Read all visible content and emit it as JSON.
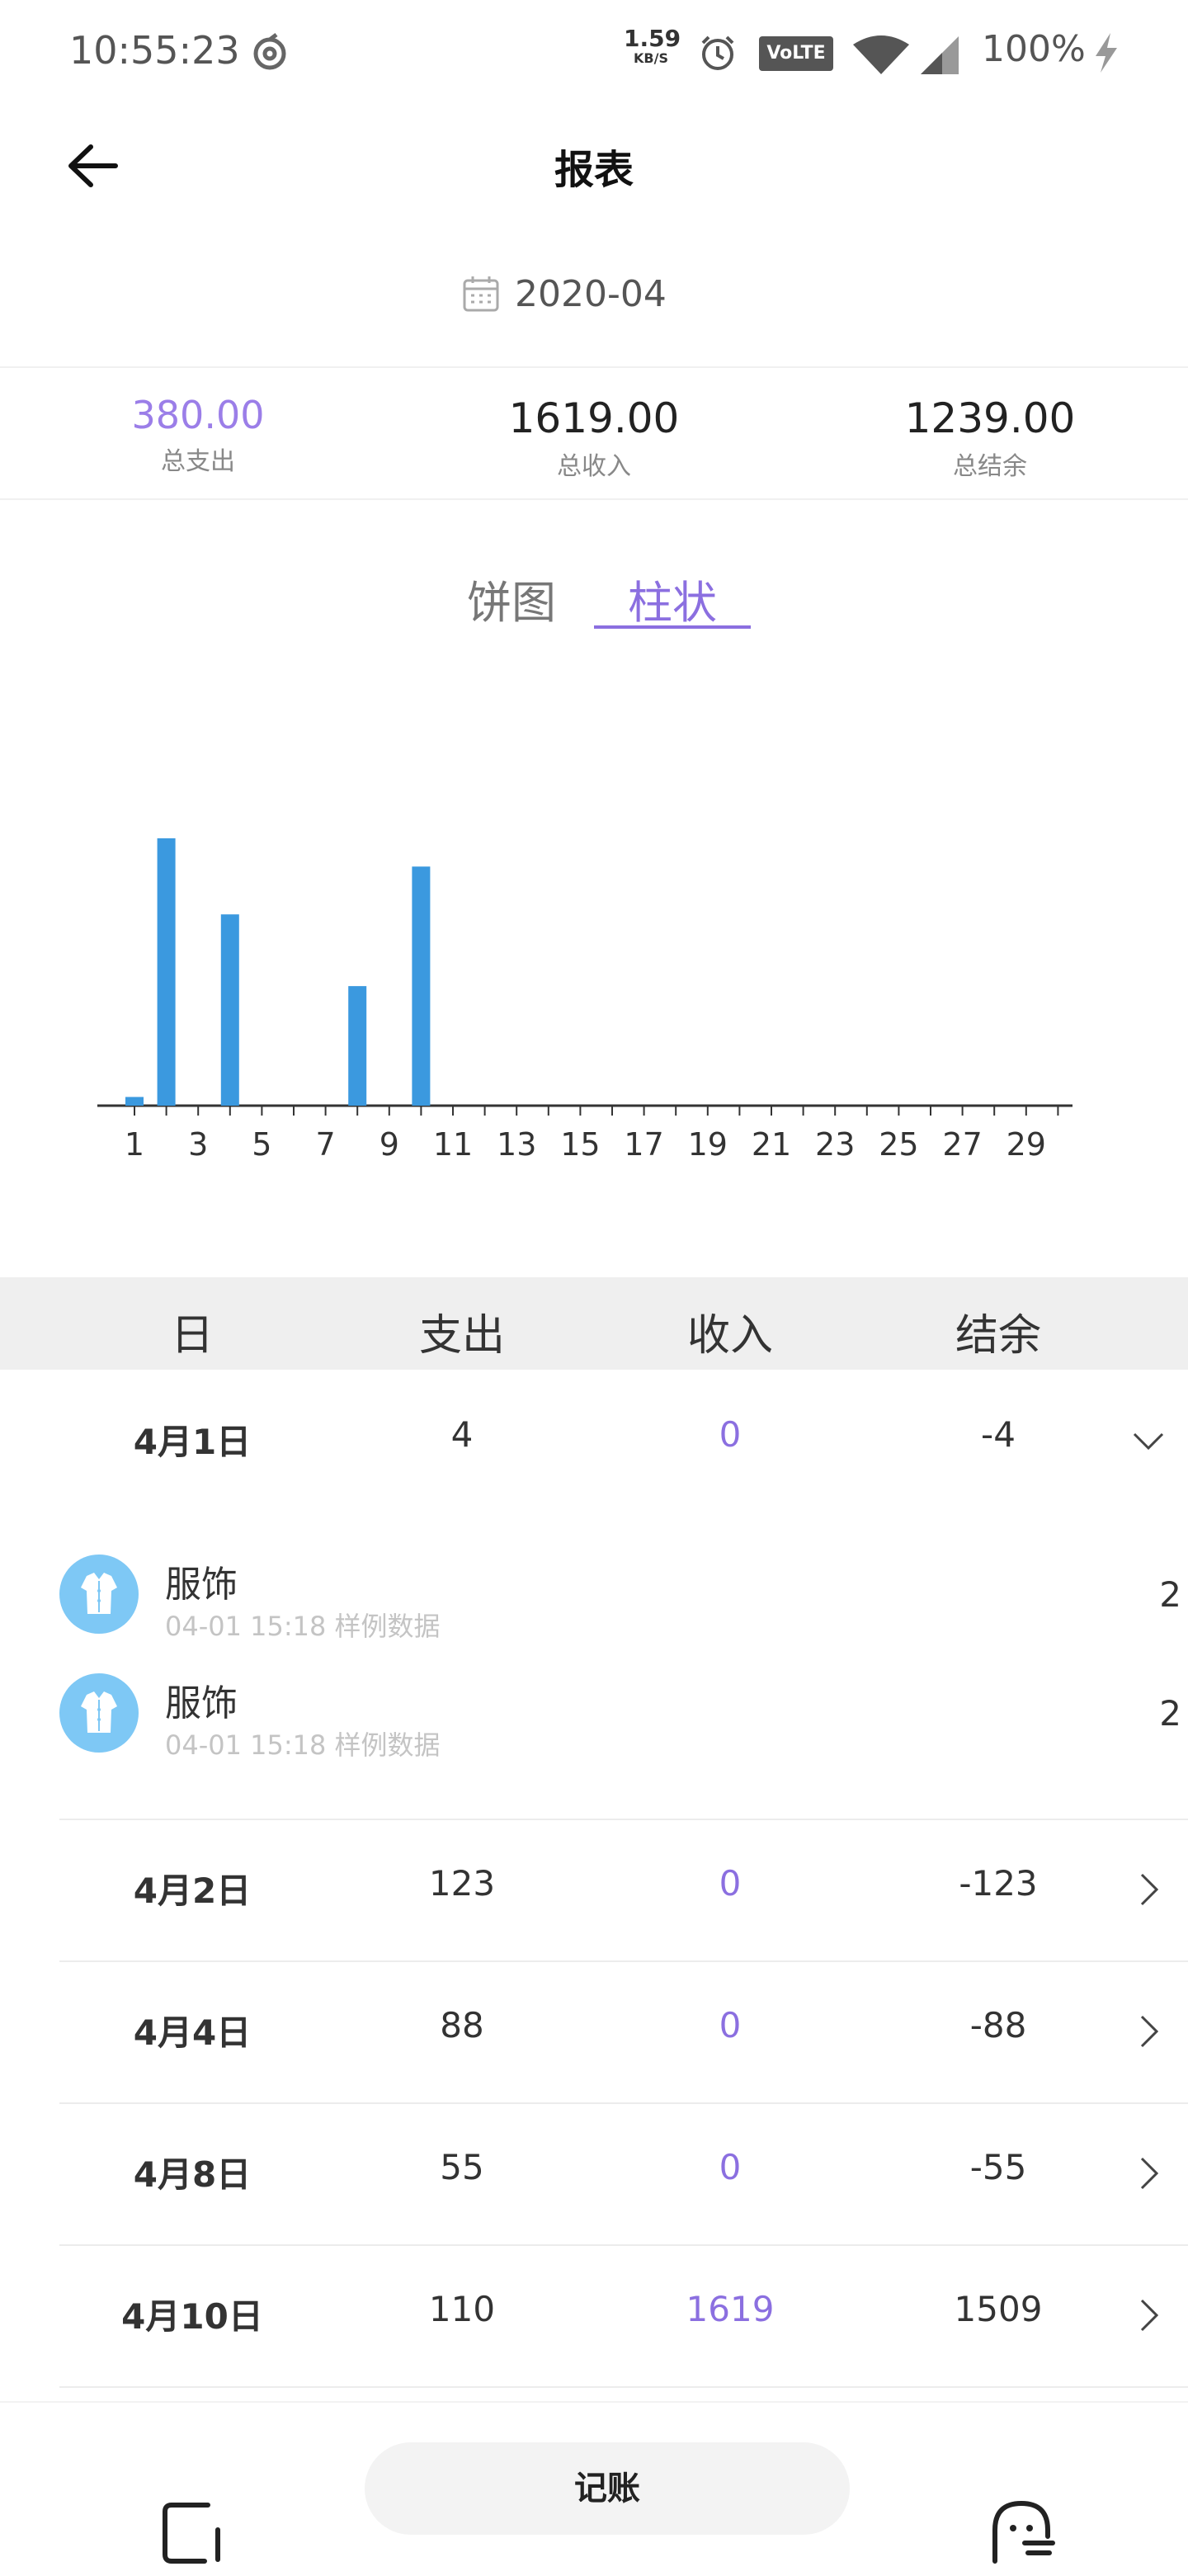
{
  "status_bar": {
    "time": "10:55:23",
    "net_speed": "1.59",
    "net_speed_unit": "KB/S",
    "volte": "VoLTE",
    "battery": "100%"
  },
  "header": {
    "title": "报表",
    "date": "2020-04"
  },
  "summary": {
    "expense": {
      "value": "380.00",
      "label": "总支出"
    },
    "income": {
      "value": "1619.00",
      "label": "总收入"
    },
    "balance": {
      "value": "1239.00",
      "label": "总结余"
    }
  },
  "tabs": [
    {
      "label": "饼图",
      "active": false
    },
    {
      "label": "柱状",
      "active": true
    }
  ],
  "chart_data": {
    "type": "bar",
    "x": [
      1,
      2,
      3,
      4,
      5,
      6,
      7,
      8,
      9,
      10,
      11,
      12,
      13,
      14,
      15,
      16,
      17,
      18,
      19,
      20,
      21,
      22,
      23,
      24,
      25,
      26,
      27,
      28,
      29,
      30
    ],
    "values": [
      4,
      123,
      0,
      88,
      0,
      0,
      0,
      55,
      0,
      110,
      0,
      0,
      0,
      0,
      0,
      0,
      0,
      0,
      0,
      0,
      0,
      0,
      0,
      0,
      0,
      0,
      0,
      0,
      0,
      0
    ],
    "tick_labels": [
      "1",
      "3",
      "5",
      "7",
      "9",
      "11",
      "13",
      "15",
      "17",
      "19",
      "21",
      "23",
      "25",
      "27",
      "29"
    ],
    "ylim": [
      0,
      123
    ],
    "color": "#3b99df"
  },
  "table": {
    "headers": [
      "日",
      "支出",
      "收入",
      "结余"
    ],
    "rows": [
      {
        "day": "4月1日",
        "expense": "4",
        "income": "0",
        "balance": "-4",
        "expanded": true
      },
      {
        "day": "4月2日",
        "expense": "123",
        "income": "0",
        "balance": "-123",
        "expanded": false
      },
      {
        "day": "4月4日",
        "expense": "88",
        "income": "0",
        "balance": "-88",
        "expanded": false
      },
      {
        "day": "4月8日",
        "expense": "55",
        "income": "0",
        "balance": "-55",
        "expanded": false
      },
      {
        "day": "4月10日",
        "expense": "110",
        "income": "1619",
        "balance": "1509",
        "expanded": false
      }
    ],
    "entries": [
      {
        "name": "服饰",
        "meta": "04-01 15:18 样例数据",
        "amount": "2",
        "icon": "shirt-icon"
      },
      {
        "name": "服饰",
        "meta": "04-01 15:18 样例数据",
        "amount": "2",
        "icon": "shirt-icon"
      }
    ]
  },
  "bottom_nav": {
    "record_label": "记账"
  },
  "colors": {
    "accent": "#8b6fe0",
    "bar": "#3b99df",
    "category_icon": "#7ec8f5"
  }
}
